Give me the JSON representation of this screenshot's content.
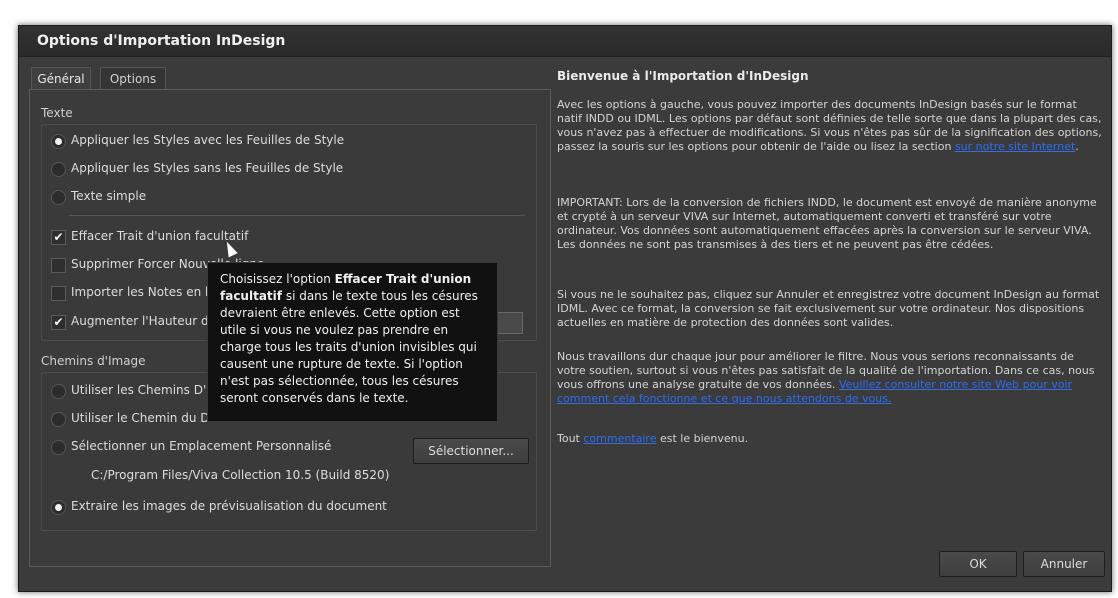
{
  "window": {
    "title": "Options d'Importation InDesign"
  },
  "tabs": [
    {
      "label": "Général",
      "active": true
    },
    {
      "label": "Options",
      "active": false
    }
  ],
  "texte": {
    "label": "Texte",
    "radios": [
      {
        "label": "Appliquer les Styles avec les Feuilles de Style",
        "checked": true
      },
      {
        "label": "Appliquer les Styles sans les Feuilles de Style",
        "checked": false
      },
      {
        "label": "Texte simple",
        "checked": false
      }
    ],
    "checks": [
      {
        "label": "Effacer Trait d'union facultatif",
        "checked": true
      },
      {
        "label": "Supprimer Forcer Nouvelle ligne",
        "checked": false
      },
      {
        "label": "Importer les Notes en bas de page",
        "checked": false
      },
      {
        "label": "Augmenter l'Hauteur de",
        "checked": true
      }
    ]
  },
  "images": {
    "label": "Chemins d'Image",
    "radios": [
      {
        "label": "Utiliser les Chemins D'Image",
        "checked": false
      },
      {
        "label": "Utiliser le Chemin du Document avec Sous-dossiers",
        "checked": false
      },
      {
        "label": "Sélectionner un Emplacement Personnalisé",
        "checked": false
      },
      {
        "label": "Extraire les images de prévisualisation du document",
        "checked": true
      }
    ],
    "select_button": "Sélectionner...",
    "path": "C:/Program Files/Viva Collection 10.5 (Build 8520)"
  },
  "tooltip": {
    "pre": "Choisissez l'option ",
    "bold": "Effacer Trait d'union facultatif",
    "post": " si dans le texte tous les césures devraient être enlevés. Cette option est utile si vous ne voulez pas prendre en charge tous les traits d'union invisibles qui causent une rupture de texte. Si l'option n'est pas sélectionnée, tous les césures seront conservés dans le texte."
  },
  "right": {
    "title": "Bienvenue à l'Importation d'InDesign",
    "p1": "Avec les options à gauche, vous pouvez importer des documents InDesign basés sur le format natif INDD ou IDML. Les options par défaut sont définies de telle sorte que dans la plupart des cas, vous n'avez pas à effectuer de modifications. Si vous n'êtes pas sûr de la signification des options, passez la souris sur les options pour obtenir de l'aide ou lisez la section ",
    "p1_link": "sur notre site Internet",
    "p1_end": ".",
    "p2": "IMPORTANT: Lors de la conversion de fichiers INDD, le document est envoyé de manière anonyme et crypté à un serveur VIVA sur Internet, automatiquement converti et transféré sur votre ordinateur. Vos données sont automatiquement effacées après la conversion sur le serveur VIVA. Les données ne sont pas transmises à des tiers et ne peuvent pas être cédées.",
    "p3": "Si vous ne le souhaitez pas, cliquez sur Annuler et enregistrez votre document InDesign au format IDML. Avec ce format, la conversion se fait exclusivement sur votre ordinateur. Nos dispositions actuelles en matière de protection des données sont valides.",
    "p4": "Nous travaillons dur chaque jour pour améliorer le filtre. Nous vous serions reconnaissants de votre soutien, surtout si vous n'êtes pas satisfait de la qualité de l'importation. Dans ce cas, nous vous offrons une analyse gratuite de vos données. ",
    "p4_link": "Veuillez consulter notre site Web pour voir comment cela fonctionne et ce que nous attendons de vous.",
    "p5_pre": "Tout ",
    "p5_link": "commentaire",
    "p5_post": " est le bienvenu."
  },
  "buttons": {
    "ok": "OK",
    "cancel": "Annuler"
  }
}
